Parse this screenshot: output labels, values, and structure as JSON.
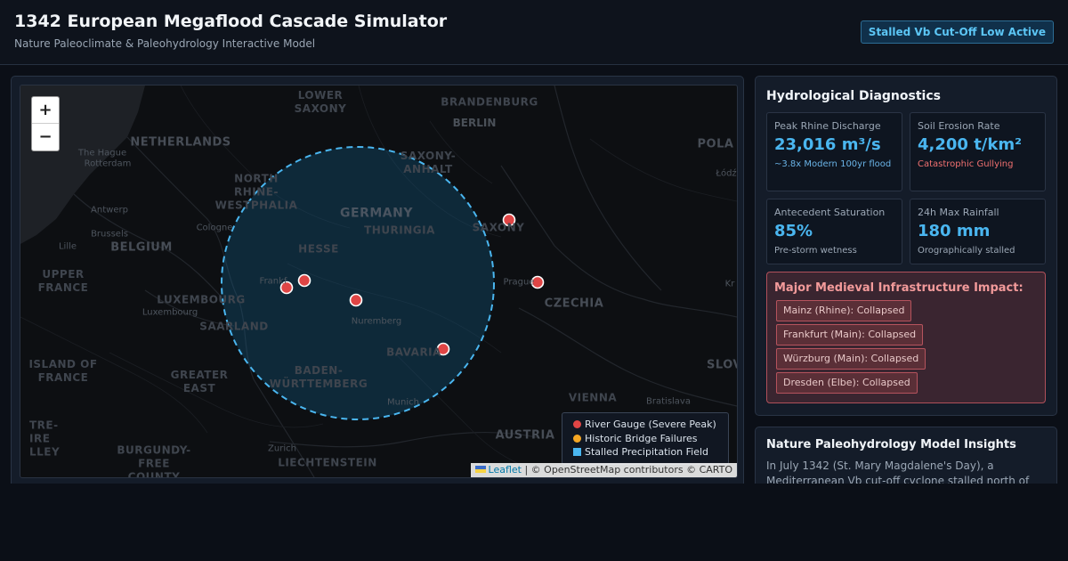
{
  "header": {
    "title": "1342 European Megaflood Cascade Simulator",
    "subtitle": "Nature Paleoclimate & Paleohydrology Interactive Model",
    "status": "Stalled Vb Cut-Off Low Active"
  },
  "map": {
    "zoom_in": "+",
    "zoom_out": "−",
    "region_labels": {
      "lower_saxony": "LOWER\nSAXONY",
      "brandenburg": "BRANDENBURG",
      "netherlands": "NETHERLANDS",
      "north_rhine": "NORTH\nRHINE-\nWESTPHALIA",
      "saxony_anhalt": "SAXONY-\nANHALT",
      "germany": "GERMANY",
      "thuringia": "THURINGIA",
      "hesse": "HESSE",
      "belgium": "BELGIUM",
      "saxony": "SAXONY",
      "upper_france": "UPPER\nFRANCE",
      "luxembourg": "LUXEMBOURG",
      "saarland": "SAARLAND",
      "czechia": "CZECHIA",
      "bavaria": "BAVARIA",
      "island_of_france": "ISLAND OF\nFRANCE",
      "greater_east": "GREATER\nEAST",
      "baden": "BADEN-\nWÜRTTEMBERG",
      "austria": "AUSTRIA",
      "vienna": "VIENNA",
      "burgundy": "BURGUNDY-\nFREE\nCOUNTY",
      "liechtenstein": "LIECHTENSTEIN",
      "polan": "POLA",
      "slov": "SLOV",
      "centre": "TRE-\nIRE\nLLEY"
    },
    "city_labels": {
      "berlin": "BERLIN",
      "hague": "The Hague",
      "rotterdam": "Rotterdam",
      "antwerp": "Antwerp",
      "brussels": "Brussels",
      "lille": "Lille",
      "cologne": "Cologne",
      "frankfurt": "Frankf",
      "luxembourg_city": "Luxembourg",
      "nuremberg": "Nuremberg",
      "prague": "Prague",
      "munich": "Munich",
      "zurich": "Zurich",
      "bratislava": "Bratislava",
      "lodz": "Łódź",
      "kr": "Kr"
    },
    "legend": {
      "items": [
        {
          "label": "River Gauge (Severe Peak)",
          "color": "#e04545"
        },
        {
          "label": "Historic Bridge Failures",
          "color": "#f5a623"
        },
        {
          "label": "Stalled Precipitation Field",
          "color": "#4ab6f0"
        }
      ]
    },
    "attribution": {
      "leaflet": "Leaflet",
      "rest": "| © OpenStreetMap contributors © CARTO"
    }
  },
  "diagnostics": {
    "title": "Hydrological Diagnostics",
    "cards": [
      {
        "label": "Peak Rhine Discharge",
        "value": "23,016 m³/s",
        "sub": "~3.8x Modern 100yr flood"
      },
      {
        "label": "Soil Erosion Rate",
        "value": "4,200 t/km²",
        "sub": "Catastrophic Gullying"
      },
      {
        "label": "Antecedent Saturation",
        "value": "85%",
        "sub": "Pre-storm wetness"
      },
      {
        "label": "24h Max Rainfall",
        "value": "180 mm",
        "sub": "Orographically stalled"
      }
    ],
    "impact": {
      "title": "Major Medieval Infrastructure Impact:",
      "tags": [
        "Mainz (Rhine): Collapsed",
        "Frankfurt (Main): Collapsed",
        "Würzburg (Main): Collapsed",
        "Dresden (Elbe): Collapsed"
      ]
    }
  },
  "insights": {
    "title": "Nature Paleohydrology Model Insights",
    "text": "In July 1342 (St. Mary Magdalene's Day), a Mediterranean Vb cut-off cyclone stalled north of"
  },
  "colors": {
    "accent": "#4ab6f0",
    "danger": "#e04545",
    "warning": "#f5a623",
    "background": "#0b0f17"
  }
}
